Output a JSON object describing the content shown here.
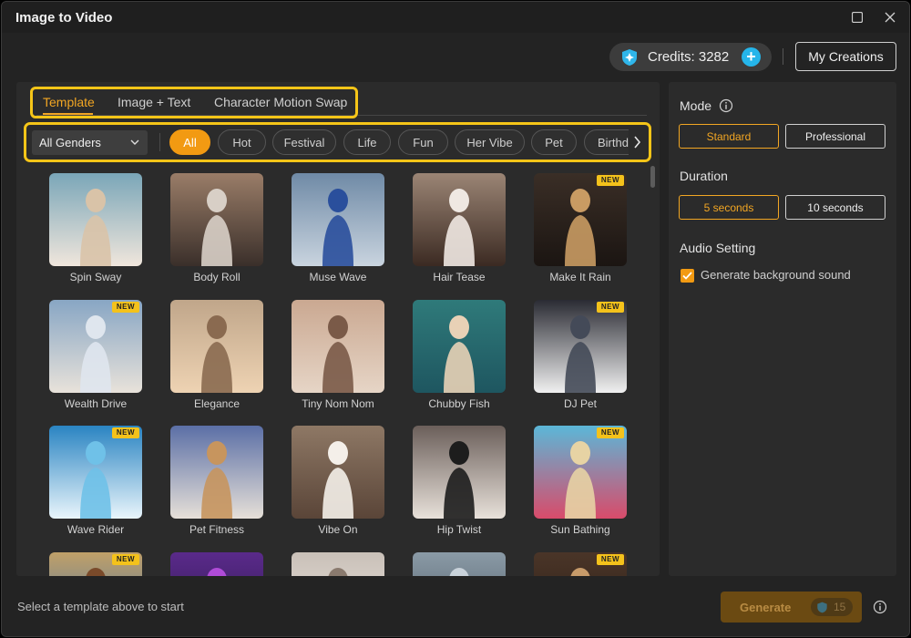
{
  "window": {
    "title": "Image to Video"
  },
  "header": {
    "credits_label": "Credits: 3282",
    "my_creations": "My Creations"
  },
  "tabs": [
    {
      "label": "Template",
      "active": true
    },
    {
      "label": "Image + Text",
      "active": false
    },
    {
      "label": "Character Motion Swap",
      "active": false
    }
  ],
  "filters": {
    "gender_selected": "All Genders",
    "chips": [
      {
        "label": "All",
        "active": true
      },
      {
        "label": "Hot",
        "active": false
      },
      {
        "label": "Festival",
        "active": false
      },
      {
        "label": "Life",
        "active": false
      },
      {
        "label": "Fun",
        "active": false
      },
      {
        "label": "Her Vibe",
        "active": false
      },
      {
        "label": "Pet",
        "active": false
      },
      {
        "label": "Birthday",
        "active": false
      }
    ]
  },
  "templates": [
    {
      "name": "Spin Sway",
      "new": false
    },
    {
      "name": "Body Roll",
      "new": false
    },
    {
      "name": "Muse Wave",
      "new": false
    },
    {
      "name": "Hair Tease",
      "new": false
    },
    {
      "name": "Make It Rain",
      "new": true
    },
    {
      "name": "Wealth Drive",
      "new": true
    },
    {
      "name": "Elegance",
      "new": false
    },
    {
      "name": "Tiny Nom Nom",
      "new": false
    },
    {
      "name": "Chubby Fish",
      "new": false
    },
    {
      "name": "DJ Pet",
      "new": true
    },
    {
      "name": "Wave Rider",
      "new": true
    },
    {
      "name": "Pet Fitness",
      "new": false
    },
    {
      "name": "Vibe On",
      "new": false
    },
    {
      "name": "Hip Twist",
      "new": false
    },
    {
      "name": "Sun Bathing",
      "new": true
    },
    {
      "name": "",
      "new": true
    },
    {
      "name": "",
      "new": false
    },
    {
      "name": "",
      "new": false
    },
    {
      "name": "",
      "new": false
    },
    {
      "name": "",
      "new": true
    }
  ],
  "badge_text": "NEW",
  "settings": {
    "mode_label": "Mode",
    "mode_options": [
      "Standard",
      "Professional"
    ],
    "mode_selected": "Standard",
    "duration_label": "Duration",
    "duration_options": [
      "5 seconds",
      "10 seconds"
    ],
    "duration_selected": "5 seconds",
    "audio_label": "Audio Setting",
    "audio_checkbox_label": "Generate background sound",
    "audio_checked": true
  },
  "footer": {
    "status": "Select a template above to start",
    "generate_label": "Generate",
    "generate_cost": "15"
  },
  "colors": {
    "accent": "#f29a12",
    "highlight": "#f5c518",
    "credits_plus": "#25b5ea"
  },
  "thumb_palettes": [
    [
      "#7aa6b8",
      "#d9c3a8",
      "#f0e6dc"
    ],
    [
      "#9a7d68",
      "#d8cfc6",
      "#3a2f2a"
    ],
    [
      "#6f8aa6",
      "#2a4f9c",
      "#c9d4df"
    ],
    [
      "#9b8575",
      "#efe8e2",
      "#3b2a22"
    ],
    [
      "#3a2e26",
      "#c99b63",
      "#1b1512"
    ],
    [
      "#88a6c4",
      "#dfe6ee",
      "#e8e2da"
    ],
    [
      "#c0a68a",
      "#8a6a50",
      "#eed3b3"
    ],
    [
      "#caa891",
      "#7a5a48",
      "#e6d5c6"
    ],
    [
      "#2f7a7a",
      "#e8d1b6",
      "#1e5660"
    ],
    [
      "#2a2b33",
      "#444a58",
      "#f0f0f0"
    ],
    [
      "#2a84c2",
      "#6fc1e8",
      "#e9f5fb"
    ],
    [
      "#5b6fa6",
      "#c7955e",
      "#e6e0d8"
    ],
    [
      "#8e7865",
      "#f4efe9",
      "#5a4538"
    ],
    [
      "#6b5f5a",
      "#1d1d1d",
      "#e8e1da"
    ],
    [
      "#5bb7d8",
      "#e7d3a4",
      "#d94b6a"
    ],
    [
      "#c0a068",
      "#7a4a2a",
      "#3a6fb0"
    ],
    [
      "#5a2a8a",
      "#b04bd8",
      "#2a184a"
    ],
    [
      "#c9c0b8",
      "#8a7a6e",
      "#efe9e3"
    ],
    [
      "#8a9aa6",
      "#c9d2da",
      "#4a5560"
    ],
    [
      "#4a3528",
      "#c79b6a",
      "#2a1c14"
    ]
  ]
}
